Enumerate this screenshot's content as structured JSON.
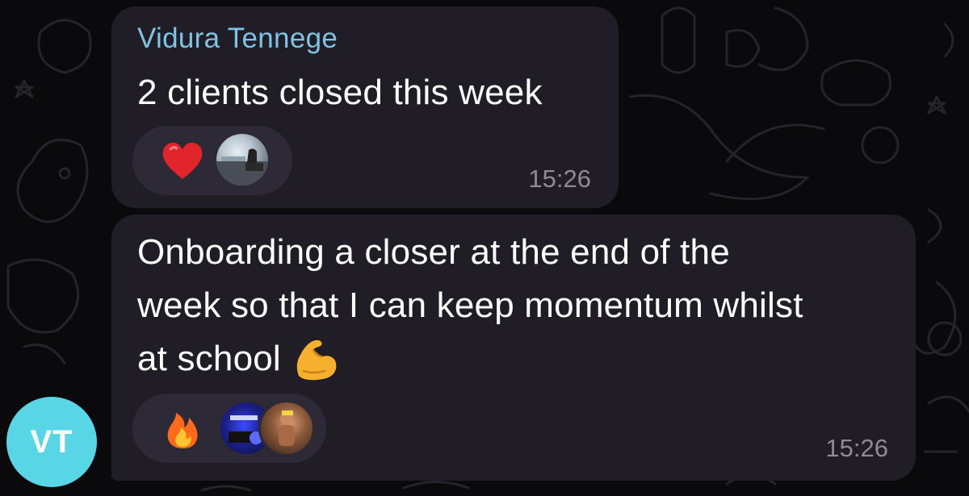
{
  "chat": {
    "avatar_initials": "VT",
    "messages": [
      {
        "sender": "Vidura Tennege",
        "text": "2 clients closed this week",
        "time": "15:26",
        "reactions": [
          {
            "emoji": "heart-icon",
            "color": "#e0252b"
          }
        ]
      },
      {
        "text_lines": [
          "Onboarding a closer at the end of the",
          "week so that I can keep momentum whilst",
          "at school"
        ],
        "inline_emoji": "flexed-biceps-icon",
        "time": "15:26",
        "reactions": [
          {
            "emoji": "fire-icon",
            "color": "#ff6a1a"
          }
        ]
      }
    ]
  },
  "colors": {
    "background": "#0a090c",
    "bubble": "#211d26",
    "reaction_pill": "#2e2936",
    "sender_name": "#7fc3e3",
    "avatar": "#59d6e6",
    "timestamp": "#8e8a96"
  }
}
